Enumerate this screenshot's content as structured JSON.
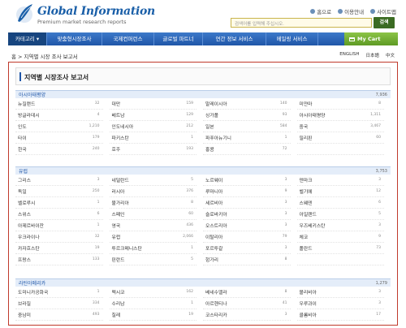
{
  "header": {
    "logo_title": "Global Information",
    "logo_subtitle": "Premium market research reports",
    "top_links": [
      "홈으로",
      "이용안내",
      "사이트맵"
    ],
    "search_placeholder": "검색어를 입력해 주십시오.",
    "search_button": "검색"
  },
  "nav": {
    "items": [
      "카테고리",
      "맞춤형시장조사",
      "국제컨퍼런스",
      "글로벌 파트너",
      "연간 정보 서비스",
      "메일링 서비스"
    ],
    "cart": "My Cart"
  },
  "breadcrumb": "홈 > 지역별 시장 조사 보고서",
  "languages": [
    "ENGLISH",
    "日本語",
    "中文"
  ],
  "page_title": "지역별 시장조사 보고서",
  "regions": [
    {
      "name": "아시아태평양",
      "count": "7,936",
      "items": [
        {
          "name": "뉴질랜드",
          "count": "32"
        },
        {
          "name": "대만",
          "count": "159"
        },
        {
          "name": "말레이시아",
          "count": "140"
        },
        {
          "name": "미얀마",
          "count": "8"
        },
        {
          "name": "방글라데시",
          "count": "4"
        },
        {
          "name": "베트남",
          "count": "129"
        },
        {
          "name": "싱가폴",
          "count": "93"
        },
        {
          "name": "아시아태평양",
          "count": "1,311"
        },
        {
          "name": "인도",
          "count": "1,210"
        },
        {
          "name": "인도네시아",
          "count": "212"
        },
        {
          "name": "일본",
          "count": "584"
        },
        {
          "name": "중국",
          "count": "3,467"
        },
        {
          "name": "타이",
          "count": "179"
        },
        {
          "name": "파키스탄",
          "count": "1"
        },
        {
          "name": "파푸아뉴기니",
          "count": "1"
        },
        {
          "name": "필리핀",
          "count": "60"
        },
        {
          "name": "한국",
          "count": "240"
        },
        {
          "name": "호주",
          "count": "193"
        },
        {
          "name": "홍콩",
          "count": "72"
        },
        {
          "name": "",
          "count": ""
        }
      ]
    },
    {
      "name": "유럽",
      "count": "3,753",
      "items": [
        {
          "name": "그리스",
          "count": "3"
        },
        {
          "name": "네덜란드",
          "count": "5"
        },
        {
          "name": "노르웨이",
          "count": "3"
        },
        {
          "name": "덴마크",
          "count": "3"
        },
        {
          "name": "독일",
          "count": "250"
        },
        {
          "name": "러시아",
          "count": "376"
        },
        {
          "name": "루마니아",
          "count": "9"
        },
        {
          "name": "벨기에",
          "count": "12"
        },
        {
          "name": "벨로루시",
          "count": "1"
        },
        {
          "name": "불가리아",
          "count": "8"
        },
        {
          "name": "세르비아",
          "count": "3"
        },
        {
          "name": "스웨덴",
          "count": "6"
        },
        {
          "name": "스위스",
          "count": "6"
        },
        {
          "name": "스페인",
          "count": "60"
        },
        {
          "name": "슬로바키아",
          "count": "3"
        },
        {
          "name": "아일랜드",
          "count": "5"
        },
        {
          "name": "아제르바이잔",
          "count": "1"
        },
        {
          "name": "영국",
          "count": "436"
        },
        {
          "name": "오스트리아",
          "count": "3"
        },
        {
          "name": "우즈베키스탄",
          "count": "3"
        },
        {
          "name": "우크라이나",
          "count": "32"
        },
        {
          "name": "유럽",
          "count": "2,066"
        },
        {
          "name": "이탈리아",
          "count": "79"
        },
        {
          "name": "체코",
          "count": "9"
        },
        {
          "name": "카자흐스탄",
          "count": "19"
        },
        {
          "name": "투르크메니스탄",
          "count": "1"
        },
        {
          "name": "포르투갈",
          "count": "3"
        },
        {
          "name": "폴란드",
          "count": "73"
        },
        {
          "name": "프랑스",
          "count": "133"
        },
        {
          "name": "핀란드",
          "count": "5"
        },
        {
          "name": "헝가리",
          "count": "8"
        },
        {
          "name": "",
          "count": ""
        }
      ]
    },
    {
      "name": "라틴아메리카",
      "count": "1,279",
      "items": [
        {
          "name": "도미니카공화국",
          "count": "1"
        },
        {
          "name": "멕시코",
          "count": "162"
        },
        {
          "name": "베네수엘라",
          "count": "8"
        },
        {
          "name": "볼리비아",
          "count": "3"
        },
        {
          "name": "브라질",
          "count": "334"
        },
        {
          "name": "수리남",
          "count": "1"
        },
        {
          "name": "아르헨티나",
          "count": "41"
        },
        {
          "name": "우루과이",
          "count": "3"
        },
        {
          "name": "중남미",
          "count": "493"
        },
        {
          "name": "칠레",
          "count": "19"
        },
        {
          "name": "코스타리카",
          "count": "3"
        },
        {
          "name": "콜롬비아",
          "count": "17"
        }
      ]
    }
  ]
}
